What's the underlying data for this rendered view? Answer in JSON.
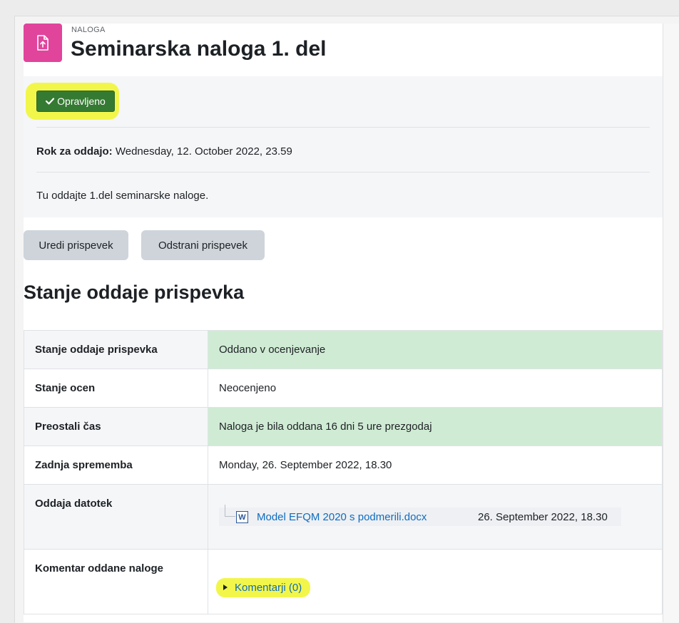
{
  "header": {
    "module_type": "NALOGA",
    "title": "Seminarska naloga 1. del",
    "module_icon": "assignment-upload-icon"
  },
  "activity": {
    "completion_label": "Opravljeno",
    "completion_icon": "check-icon",
    "due_label": "Rok za oddajo:",
    "due_value": "Wednesday, 12. October 2022, 23.59",
    "description": "Tu oddajte 1.del seminarske naloge."
  },
  "actions": {
    "edit_label": "Uredi prispevek",
    "remove_label": "Odstrani prispevek"
  },
  "submission": {
    "section_title": "Stanje oddaje prispevka",
    "rows": [
      {
        "label": "Stanje oddaje prispevka",
        "value": "Oddano v ocenjevanje"
      },
      {
        "label": "Stanje ocen",
        "value": "Neocenjeno"
      },
      {
        "label": "Preostali čas",
        "value": "Naloga je bila oddana 16 dni 5 ure prezgodaj"
      },
      {
        "label": "Zadnja sprememba",
        "value": "Monday, 26. September 2022, 18.30"
      },
      {
        "label": "Oddaja datotek"
      },
      {
        "label": "Komentar oddane naloge"
      }
    ],
    "file": {
      "name": "Model EFQM 2020 s podmerili.docx",
      "date": "26. September 2022, 18.30",
      "icon": "word-document-icon",
      "icon_letter": "W"
    },
    "comments_label": "Komentarji (0)"
  },
  "colors": {
    "module_icon_bg": "#e1449b",
    "completion_bg": "#357a32",
    "success_row_bg": "#d0ebd4",
    "highlight": "#f2f64a",
    "link": "#0f6cbf"
  }
}
